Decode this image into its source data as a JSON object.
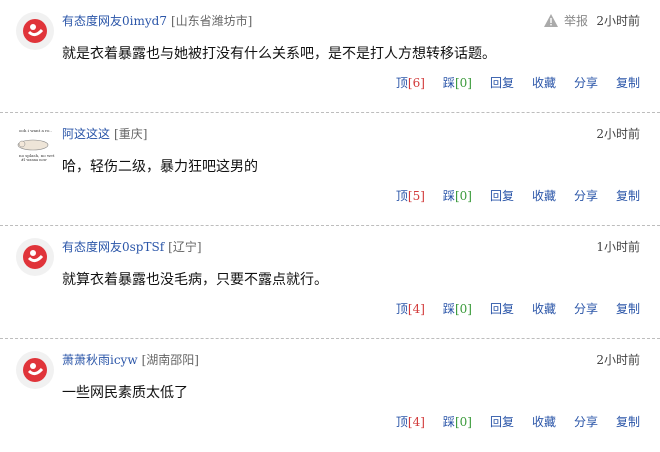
{
  "comments": [
    {
      "username": "有态度网友0imyd7",
      "location": "[山东省潍坊市]",
      "report_label": "举报",
      "time": "2小时前",
      "content": "就是衣着暴露也与她被打没有什么关系吧，是不是打人方想转移话题。",
      "up_label": "顶",
      "up_count": "[6]",
      "down_label": "踩",
      "down_count": "[0]",
      "reply": "回复",
      "fav": "收藏",
      "share": "分享",
      "copy": "复制",
      "avatar": "netease-logo-icon"
    },
    {
      "username": "阿这这这",
      "location": "[重庆]",
      "time": "2小时前",
      "content": "哈，轻伤二级，暴力狂吧这男的",
      "up_label": "顶",
      "up_count": "[5]",
      "down_label": "踩",
      "down_count": "[0]",
      "reply": "回复",
      "fav": "收藏",
      "share": "分享",
      "copy": "复制",
      "avatar": "meme-avatar-icon"
    },
    {
      "username": "有态度网友0spTSf",
      "location": "[辽宁]",
      "time": "1小时前",
      "content": "就算衣着暴露也没毛病，只要不露点就行。",
      "up_label": "顶",
      "up_count": "[4]",
      "down_label": "踩",
      "down_count": "[0]",
      "reply": "回复",
      "fav": "收藏",
      "share": "分享",
      "copy": "复制",
      "avatar": "netease-logo-icon"
    },
    {
      "username": "萧萧秋雨icyw",
      "location": "[湖南邵阳]",
      "time": "2小时前",
      "content": "一些网民素质太低了",
      "up_label": "顶",
      "up_count": "[4]",
      "down_label": "踩",
      "down_count": "[0]",
      "reply": "回复",
      "fav": "收藏",
      "share": "分享",
      "copy": "复制",
      "avatar": "netease-logo-icon"
    }
  ],
  "colors": {
    "link": "#2a55a8",
    "up_count": "#d23b3b",
    "down_count": "#3a9a3a",
    "logo": "#e0343a"
  }
}
